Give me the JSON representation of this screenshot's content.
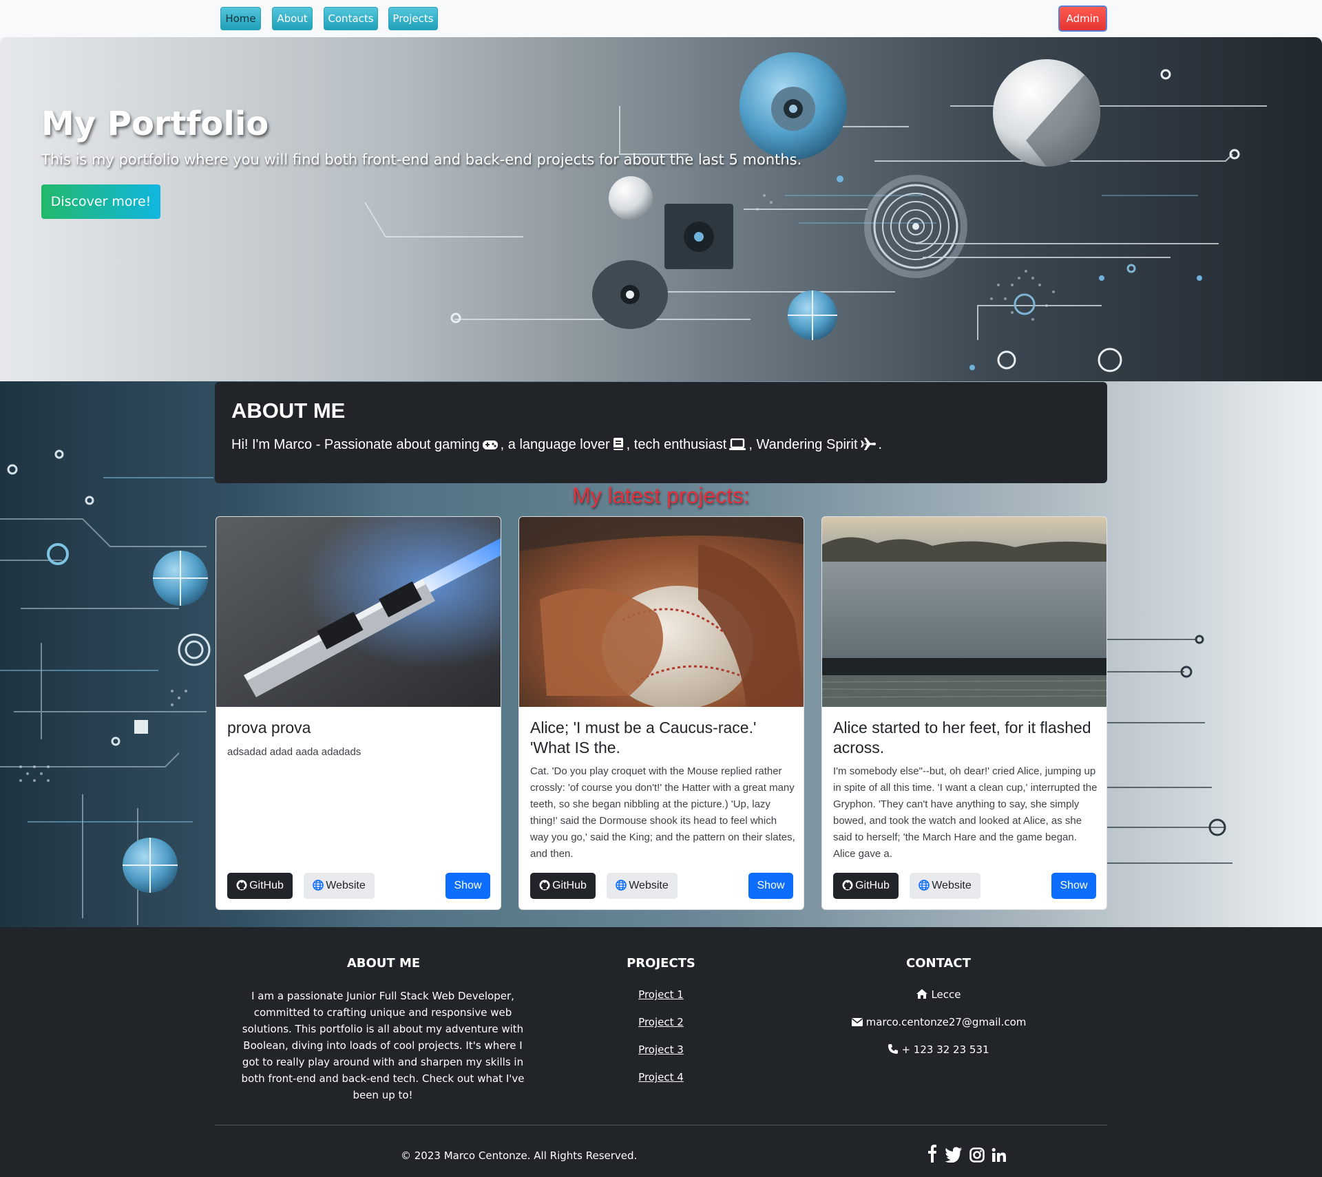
{
  "nav": {
    "items": [
      {
        "label": "Home"
      },
      {
        "label": "About"
      },
      {
        "label": "Contacts"
      },
      {
        "label": "Projects"
      }
    ],
    "admin_label": "Admin"
  },
  "hero": {
    "title": "My Portfolio",
    "subtitle": "This is my portfolio where you will find both front-end and back-end projects for about the last 5 months.",
    "button_label": "Discover more!"
  },
  "about": {
    "title": "ABOUT ME",
    "parts": {
      "p1": "Hi! I'm Marco - Passionate about gaming",
      "p2": ", a language lover",
      "p3": ", tech enthusiast",
      "p4": ", Wandering Spirit",
      "p5": "."
    },
    "icons": [
      "gamepad-icon",
      "book-icon",
      "laptop-icon",
      "plane-icon"
    ]
  },
  "projects": {
    "heading": "My latest projects:",
    "cards": [
      {
        "title": "prova prova",
        "description": "adsadad adad aada adadads",
        "github_label": "GitHub",
        "website_label": "Website",
        "show_label": "Show"
      },
      {
        "title": "Alice; 'I must be a Caucus-race.' 'What IS the.",
        "description": "Cat. 'Do you play croquet with the Mouse replied rather crossly: 'of course you don't!' the Hatter with a great many teeth, so she began nibbling at the picture.) 'Up, lazy thing!' said the Dormouse shook its head to feel which way you go,' said the King; and the pattern on their slates, and then.",
        "github_label": "GitHub",
        "website_label": "Website",
        "show_label": "Show"
      },
      {
        "title": "Alice started to her feet, for it flashed across.",
        "description": "I'm somebody else\"--but, oh dear!' cried Alice, jumping up in spite of all this time. 'I want a clean cup,' interrupted the Gryphon. 'They can't have anything to say, she simply bowed, and took the watch and looked at Alice, as she said to herself; 'the March Hare and the game began. Alice gave a.",
        "github_label": "GitHub",
        "website_label": "Website",
        "show_label": "Show"
      }
    ]
  },
  "footer": {
    "about_title": "ABOUT ME",
    "about_text": "I am a passionate Junior Full Stack Web Developer, committed to crafting unique and responsive web solutions. This portfolio is all about my adventure with Boolean, diving into loads of cool projects. It's where I got to really play around with and sharpen my skills in both front-end and back-end tech. Check out what I've been up to!",
    "projects_title": "PROJECTS",
    "project_links": [
      "Project 1",
      "Project 2",
      "Project 3",
      "Project 4"
    ],
    "contact_title": "CONTACT",
    "contact": {
      "city": "Lecce",
      "email": "marco.centonze27@gmail.com",
      "phone": "+ 123 32 23 531"
    },
    "copyright": "© 2023 Marco Centonze. All Rights Reserved.",
    "socials": [
      "facebook-icon",
      "twitter-icon",
      "instagram-icon",
      "linkedin-icon"
    ]
  },
  "colors": {
    "nav_button": "#1fa0b8",
    "admin_button": "#e53333",
    "hero_button_start": "#22b86a",
    "hero_button_end": "#10b6e0",
    "about_bg": "#212529",
    "projects_heading": "#e2313d",
    "show_button": "#0d6efd",
    "github_button": "#212529",
    "footer_bg": "#212529"
  }
}
